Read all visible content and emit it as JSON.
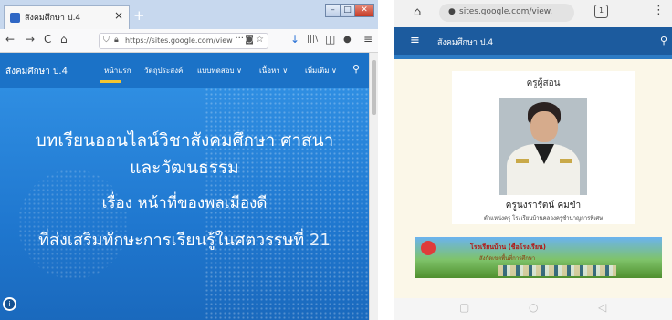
{
  "desktop": {
    "tab_title": "สังคมศึกษา ป.4",
    "tab_close": "×",
    "new_tab": "+",
    "win_min": "–",
    "win_max": "□",
    "win_close": "✕",
    "nav": {
      "back": "←",
      "forward": "→",
      "reload": "C",
      "home": "⌂"
    },
    "address_url": "https://sites.google.com/view",
    "address_more": "···",
    "toolbar": {
      "download": "↓",
      "library": "|||\\",
      "reader": "◫",
      "account": "●",
      "menu": "≡"
    },
    "site_name": "สังคมศึกษา ป.4",
    "site_nav": [
      "หน้าแรก",
      "วัตถุประสงค์",
      "แบบทดสอบ ∨",
      "เนื้อหา ∨",
      "เพิ่มเติม ∨"
    ],
    "active_nav": "หน้าแรก",
    "hero_lines": [
      "บทเรียนออนไลน์วิชาสังคมศึกษา ศาสนา",
      "และวัฒนธรรม",
      "เรื่อง หน้าที่ของพลเมืองดี",
      "ที่ส่งเสริมทักษะการเรียนรู้ในศตวรรษที่"
    ],
    "hero_century": "21",
    "info_icon": "i"
  },
  "mobile": {
    "address_url": "sites.google.com/view.",
    "tab_count": "1",
    "menu": "⋮",
    "site_title": "สังคมศึกษา ป.4",
    "card_title": "ครูผู้สอน",
    "teacher_name": "ครูนงรารัตน์ คมขำ",
    "teacher_role": "ตำแหน่งครู โรงเรียนบ้านคลองครูชำนาญการพิเศษ",
    "banner_text": "โรงเรียนบ้าน (ชื่อโรงเรียน)",
    "banner_sub": "สังกัดเขตพื้นที่การศึกษา",
    "nav_buttons": [
      "▢",
      "○",
      "◁"
    ]
  }
}
